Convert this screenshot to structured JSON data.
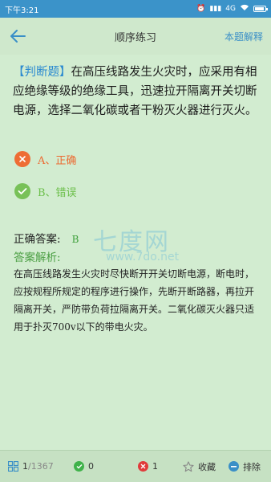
{
  "status_bar": {
    "time": "下午3:21",
    "signal": "4G"
  },
  "nav": {
    "title": "顺序练习",
    "action": "本题解释"
  },
  "question": {
    "type_label": "【判断题】",
    "text": "在高压线路发生火灾时，应采用有相应绝缘等级的绝缘工具，迅速拉开隔离开关切断电源，选择二氧化碳或者干粉灭火器进行灭火。"
  },
  "options": [
    {
      "label": "A、正确",
      "state": "wrong",
      "icon": "x-icon",
      "color": "#ee6d34"
    },
    {
      "label": "B、错误",
      "state": "correct",
      "icon": "check-icon",
      "color": "#78c158"
    }
  ],
  "answer": {
    "label": "正确答案:",
    "value": "B"
  },
  "analysis": {
    "label": "答案解析:",
    "text": "在高压线路发生火灾时尽快断开开关切断电源，断电时，应按规程所规定的程序进行操作，先断开断路器，再拉开隔离开关，严防带负荷拉隔离开关。二氧化碳灭火器只适用于扑灭700v以下的带电火灾。"
  },
  "watermark": {
    "brand": "七度网",
    "url": "www.7do.net"
  },
  "bottom_bar": {
    "progress_current": "1",
    "progress_total": "/1367",
    "correct_count": "0",
    "wrong_count": "1",
    "favorite_label": "收藏",
    "remove_label": "排除"
  }
}
